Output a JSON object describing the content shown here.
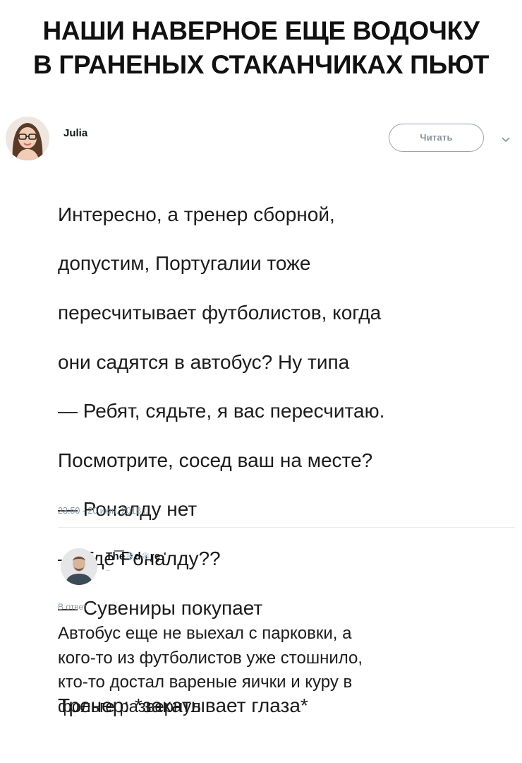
{
  "caption": {
    "line1": "НАШИ НАВЕРНОЕ ЕЩЕ ВОДОЧКУ",
    "line2": "В ГРАНЕНЫХ СТАКАНЧИКАХ ПЬЮТ"
  },
  "tweet": {
    "author": "Julia",
    "follow_label": "Читать",
    "lines": [
      "Интересно, а тренер сборной,",
      "допустим, Португалии тоже",
      "пересчитывает футболистов, когда",
      "они садятся в автобус? Ну типа",
      "— Ребят, сядьте, я вас пересчитаю.",
      "Посмотрите, сосед ваш на месте?",
      "— Роналду нет",
      "— Где Роналду??",
      "— Сувениры покупает"
    ],
    "last_line": "Тренер: *закатывает глаза*",
    "timestamp": "23:50 - 20 июн. 2018 г."
  },
  "reply": {
    "name_part1": "Th͞e",
    "flake1": "❄",
    "name_part2": "d",
    "flake2": "❄",
    "name_part3": "r̨ȩ '",
    "sub": "–",
    "in_reply_to": "В ответ",
    "in_reply_handle": "·",
    "lines": [
      "Автобус еще не выехал с парковки, а",
      "кого-то из футболистов уже стошнило,",
      "кто-то достал вареные яички и куру в",
      "фольге развернул"
    ]
  },
  "colors": {
    "follow_border": "#9aa3ad",
    "muted_text": "#8899a6",
    "divider": "#e6ecf0"
  },
  "icons": [
    "chevron-down-icon",
    "avatar-julia",
    "avatar-reply"
  ]
}
